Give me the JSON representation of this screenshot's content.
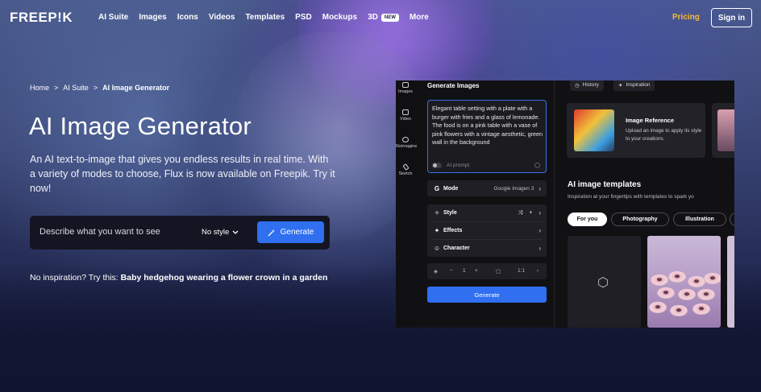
{
  "nav": {
    "logo": "FREEP!K",
    "links": [
      "AI Suite",
      "Images",
      "Icons",
      "Videos",
      "Templates",
      "PSD",
      "Mockups",
      "3D",
      "More"
    ],
    "badge_new": "NEW",
    "pricing": "Pricing",
    "signin": "Sign in"
  },
  "breadcrumb": {
    "items": [
      "Home",
      "AI Suite",
      "AI Image Generator"
    ],
    "separator": ">"
  },
  "hero": {
    "title": "AI Image Generator",
    "description": "An AI text-to-image that gives you endless results in real time. With a variety of modes to choose, Flux is now available on Freepik. Try it now!",
    "search_placeholder": "Describe what you want to see",
    "style_label": "No style",
    "generate_label": "Generate",
    "inspiration_prefix": "No inspiration? Try this: ",
    "inspiration_example": "Baby hedgehog wearing a flower crown in a garden"
  },
  "app": {
    "sidebar": [
      "Images",
      "Video",
      "Reimagine",
      "Sketch"
    ],
    "panel_title": "Generate Images",
    "prompt": "Elegant table setting with a plate with a burger with fries and a glass of lemonade. The food is on a pink table with a vase of pink flowers with a vintage aesthetic, green wall in the background",
    "ai_prompt_label": "AI prompt",
    "mode_label": "Mode",
    "mode_value": "Google Imagen 3",
    "style_label": "Style",
    "effects_label": "Effects",
    "character_label": "Character",
    "count_value": "1",
    "count_minus": "−",
    "count_plus": "+",
    "ratio_value": "1:1",
    "generate_label": "Generate",
    "history_label": "History",
    "inspiration_label": "Inspiration",
    "ref_title": "Image Reference",
    "ref_text": "Upload an image to apply its style to your creations.",
    "templates_title": "AI image templates",
    "templates_sub": "Inspiration at your fingertips with templates to spark yo",
    "chips": [
      "For you",
      "Photography",
      "Illustration"
    ]
  }
}
